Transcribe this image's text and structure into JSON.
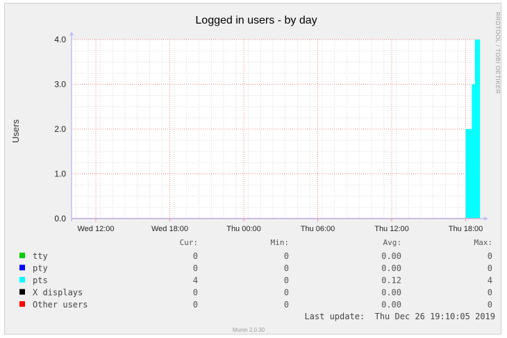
{
  "chart_data": {
    "type": "area",
    "title": "Logged in users - by day",
    "ylabel": "Users",
    "ylim": [
      0,
      4
    ],
    "y_ticks": [
      "0.0",
      "1.0",
      "2.0",
      "3.0",
      "4.0"
    ],
    "x_ticks": [
      "Wed 12:00",
      "Wed 18:00",
      "Thu 00:00",
      "Thu 06:00",
      "Thu 12:00",
      "Thu 18:00"
    ],
    "grid": true,
    "side_label": "RRDTOOL / TOBI OETIKER",
    "stats_header": {
      "cur": "Cur:",
      "min": "Min:",
      "avg": "Avg:",
      "max": "Max:"
    },
    "series": [
      {
        "name": "tty",
        "color": "#00cc00",
        "cur": "0",
        "min": "0",
        "avg": "0.00",
        "max": "0"
      },
      {
        "name": "pty",
        "color": "#0000ff",
        "cur": "0",
        "min": "0",
        "avg": "0.00",
        "max": "0"
      },
      {
        "name": "pts",
        "color": "#00ffff",
        "cur": "4",
        "min": "0",
        "avg": "0.12",
        "max": "4",
        "x": [
          "Thu 18:00",
          "Thu 18:15",
          "Thu 18:30",
          "Thu 18:45",
          "Thu 19:00",
          "Thu 19:10"
        ],
        "values": [
          0,
          2,
          2,
          3,
          4,
          4
        ]
      },
      {
        "name": "X displays",
        "color": "#000000",
        "cur": "0",
        "min": "0",
        "avg": "0.00",
        "max": "0"
      },
      {
        "name": "Other users",
        "color": "#ff0000",
        "cur": "0",
        "min": "0",
        "avg": "0.00",
        "max": "0"
      }
    ],
    "last_update": "Last update:  Thu Dec 26 19:10:05 2019",
    "footer": "Munin 2.0.30"
  }
}
